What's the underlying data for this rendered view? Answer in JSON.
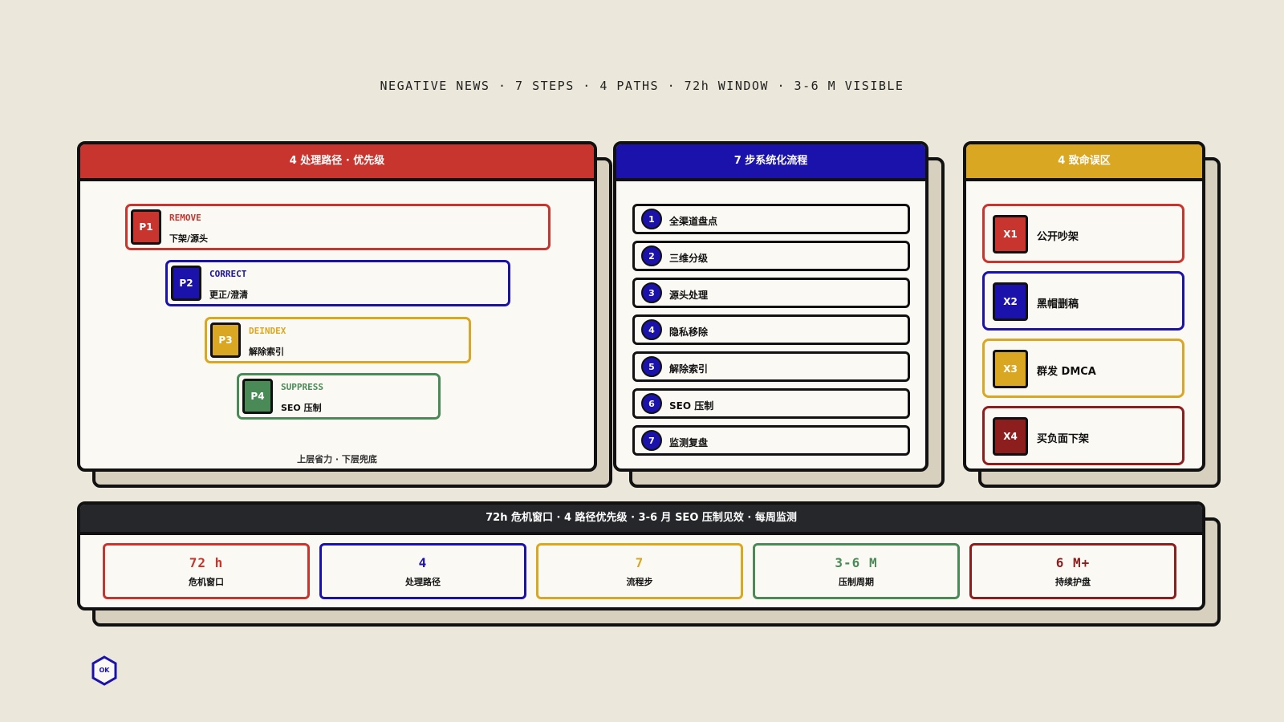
{
  "headline": "NEGATIVE NEWS · 7 STEPS · 4 PATHS · 72h WINDOW · 3-6 M VISIBLE",
  "colors": {
    "red": "#c8352e",
    "blue": "#1a12aa",
    "yellow": "#d9a722",
    "green": "#4a8a57",
    "maroon": "#8c1e1e",
    "dark": "#26272b"
  },
  "paths_card": {
    "title": "4 处理路径 · 优先级",
    "items": [
      {
        "badge": "P1",
        "code": "REMOVE",
        "label": "下架/源头"
      },
      {
        "badge": "P2",
        "code": "CORRECT",
        "label": "更正/澄清"
      },
      {
        "badge": "P3",
        "code": "DEINDEX",
        "label": "解除索引"
      },
      {
        "badge": "P4",
        "code": "SUPPRESS",
        "label": "SEO 压制"
      }
    ],
    "footnote": "上层省力 · 下层兜底"
  },
  "steps_card": {
    "title": "7 步系统化流程",
    "items": [
      {
        "num": "1",
        "label": "全渠道盘点"
      },
      {
        "num": "2",
        "label": "三维分级"
      },
      {
        "num": "3",
        "label": "源头处理"
      },
      {
        "num": "4",
        "label": "隐私移除"
      },
      {
        "num": "5",
        "label": "解除索引"
      },
      {
        "num": "6",
        "label": "SEO 压制"
      },
      {
        "num": "7",
        "label": "监测复盘"
      }
    ]
  },
  "pitfalls_card": {
    "title": "4 致命误区",
    "items": [
      {
        "badge": "X1",
        "label": "公开吵架"
      },
      {
        "badge": "X2",
        "label": "黑帽删稿"
      },
      {
        "badge": "X3",
        "label": "群发 DMCA"
      },
      {
        "badge": "X4",
        "label": "买负面下架"
      }
    ]
  },
  "summary": {
    "title": "72h 危机窗口 · 4 路径优先级 · 3-6 月 SEO 压制见效 · 每周监测",
    "metrics": [
      {
        "value": "72 h",
        "label": "危机窗口"
      },
      {
        "value": "4",
        "label": "处理路径"
      },
      {
        "value": "7",
        "label": "流程步"
      },
      {
        "value": "3-6 M",
        "label": "压制周期"
      },
      {
        "value": "6 M+",
        "label": "持续护盘"
      }
    ]
  },
  "ok_badge": {
    "text": "OK",
    "icon": "hexagon-icon"
  }
}
